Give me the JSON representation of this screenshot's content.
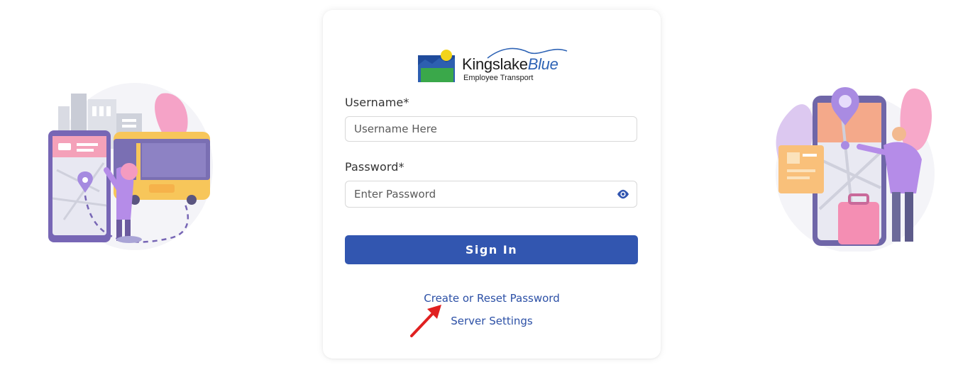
{
  "brand": {
    "name_primary": "Kingslake",
    "name_accent": "Blue",
    "subtitle": "Employee Transport",
    "accent_color": "#2e63b5"
  },
  "form": {
    "username_label": "Username*",
    "username_placeholder": "Username Here",
    "username_value": "",
    "password_label": "Password*",
    "password_placeholder": "Enter Password",
    "password_value": "",
    "password_toggle_icon": "eye-icon",
    "submit_label": "Sign In",
    "submit_color": "#3256b0"
  },
  "links": {
    "reset_password": "Create or Reset Password",
    "server_settings": "Server Settings",
    "link_color": "#2c50a6"
  },
  "annotation": {
    "arrow_icon": "red-arrow-icon",
    "arrow_color": "#e02020"
  },
  "illustrations": {
    "left": "bus-map-illustration",
    "right": "phone-map-traveler-illustration"
  }
}
